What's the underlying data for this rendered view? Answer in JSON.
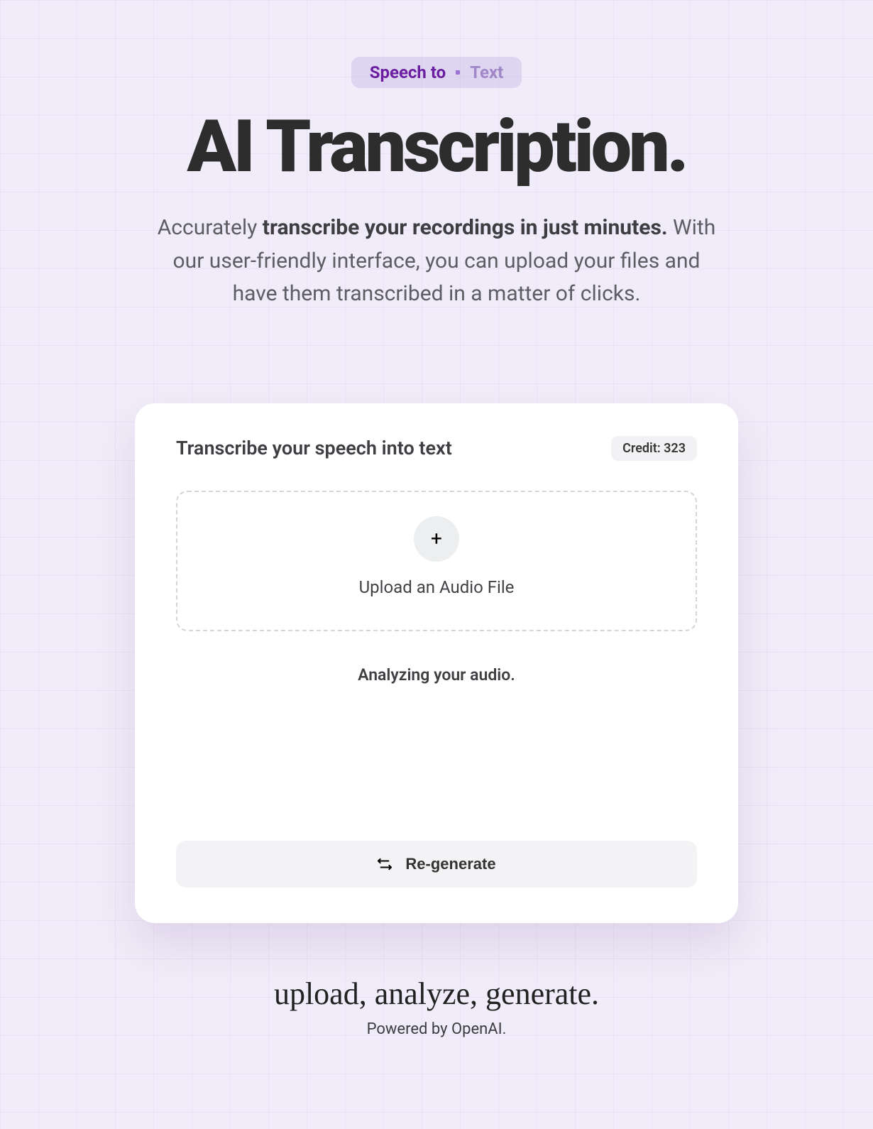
{
  "pill": {
    "left": "Speech to",
    "right": "Text"
  },
  "title": "AI Transcription.",
  "subtitle": {
    "pre": "Accurately ",
    "bold": "transcribe your recordings in just minutes.",
    "post": " With our user-friendly interface, you can upload your files and have them transcribed in a matter of clicks."
  },
  "card": {
    "title": "Transcribe your speech into text",
    "credit_label": "Credit: 323",
    "upload_label": "Upload an Audio File",
    "analyzing_label": "Analyzing your audio.",
    "regenerate_label": "Re-generate"
  },
  "footer": {
    "tagline": "upload, analyze, generate.",
    "powered": "Powered by OpenAI."
  }
}
